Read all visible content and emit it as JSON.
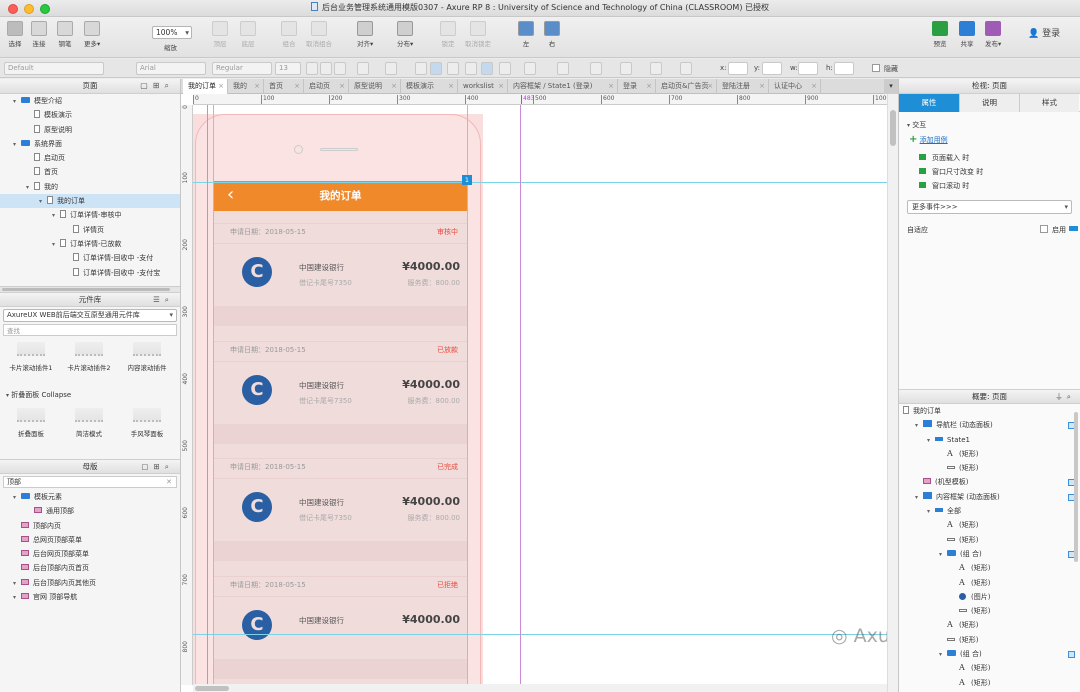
{
  "window": {
    "title": "后台业务管理系统通用模版0307 - Axure RP 8 : University of Science and Technology of China (CLASSROOM) 已授权"
  },
  "toolbar": {
    "tools": [
      {
        "label": "选择"
      },
      {
        "label": "连接"
      },
      {
        "label": "钢笔"
      },
      {
        "label": "更多▾"
      }
    ],
    "zoom_value": "100%",
    "zoom_label": "缩放",
    "arrange": [
      {
        "label": "顶层"
      },
      {
        "label": "底层"
      },
      {
        "label": "组合"
      },
      {
        "label": "取消组合"
      },
      {
        "label": "对齐▾"
      },
      {
        "label": "分布▾"
      },
      {
        "label": "锁定"
      },
      {
        "label": "取消锁定"
      },
      {
        "label": "左"
      },
      {
        "label": "右"
      }
    ],
    "right": [
      {
        "label": "预览"
      },
      {
        "label": "共享"
      },
      {
        "label": "发布▾"
      }
    ],
    "login_label": "登录"
  },
  "format": {
    "style": "Default",
    "font": "Arial",
    "weight": "Regular",
    "size": "13",
    "x_label": "x:",
    "y_label": "y:",
    "w_label": "w:",
    "h_label": "h:",
    "hidden_label": "隐藏"
  },
  "pages_panel": {
    "title": "页面",
    "items": [
      {
        "label": "模型介绍",
        "icon": "folder",
        "indent": 1
      },
      {
        "label": "模板演示",
        "icon": "page",
        "indent": 2
      },
      {
        "label": "原型说明",
        "icon": "page",
        "indent": 2
      },
      {
        "label": "系统界面",
        "icon": "folder",
        "indent": 1
      },
      {
        "label": "启动页",
        "icon": "page",
        "indent": 2
      },
      {
        "label": "首页",
        "icon": "page",
        "indent": 2
      },
      {
        "label": "我的",
        "icon": "page",
        "indent": 2
      },
      {
        "label": "我的订单",
        "icon": "page",
        "indent": 3,
        "selected": true
      },
      {
        "label": "订单详情-审核中",
        "icon": "page",
        "indent": 4
      },
      {
        "label": "详情页",
        "icon": "page",
        "indent": 5
      },
      {
        "label": "订单详情-已放款",
        "icon": "page",
        "indent": 4
      },
      {
        "label": "订单详情-回收中 -支付",
        "icon": "page",
        "indent": 5
      },
      {
        "label": "订单详情-回收中 -支付宝",
        "icon": "page",
        "indent": 5
      }
    ]
  },
  "library_panel": {
    "title": "元件库",
    "selected": "AxureUX WEB前后端交互原型通用元件库",
    "search_placeholder": "查找",
    "row1": [
      {
        "label": "卡片滚动插件1"
      },
      {
        "label": "卡片滚动插件2"
      },
      {
        "label": "内容滚动插件"
      }
    ],
    "section": "折叠面板 Collapse",
    "row2": [
      {
        "label": "折叠面板"
      },
      {
        "label": "简洁模式"
      },
      {
        "label": "手风琴面板"
      }
    ]
  },
  "masters_panel": {
    "title": "母版",
    "search_value": "顶部",
    "items": [
      {
        "label": "模板元素",
        "icon": "folder",
        "indent": 1
      },
      {
        "label": "通用顶部",
        "icon": "master",
        "indent": 2
      },
      {
        "label": "顶部内页",
        "icon": "master",
        "indent": 1
      },
      {
        "label": "总网页顶部菜单",
        "icon": "master",
        "indent": 1
      },
      {
        "label": "后台网页顶部菜单",
        "icon": "master",
        "indent": 1
      },
      {
        "label": "后台顶部内页首页",
        "icon": "master",
        "indent": 1
      },
      {
        "label": "后台顶部内页其他页",
        "icon": "master",
        "indent": 1
      },
      {
        "label": "官网 顶部导航",
        "icon": "master",
        "indent": 1
      }
    ]
  },
  "tabs": [
    {
      "label": "我的订单",
      "active": true
    },
    {
      "label": "我的"
    },
    {
      "label": "首页"
    },
    {
      "label": "启动页"
    },
    {
      "label": "原型说明"
    },
    {
      "label": "模板演示"
    },
    {
      "label": "workslist"
    },
    {
      "label": "内容框架 / State1 (登录)"
    },
    {
      "label": "登录"
    },
    {
      "label": "启动页&广告页"
    },
    {
      "label": "登陆注册"
    },
    {
      "label": "认证中心"
    }
  ],
  "ruler": {
    "h": [
      "0",
      "100",
      "200",
      "300",
      "400",
      "500",
      "600",
      "700",
      "800",
      "900",
      "1000"
    ],
    "v": [
      "0",
      "100",
      "200",
      "300",
      "400",
      "500",
      "600",
      "700",
      "800"
    ],
    "guide_value": "483",
    "badge": "1"
  },
  "phone": {
    "header_title": "我的订单",
    "back_icon": "‹",
    "orders": [
      {
        "date": "申请日期：2018-05-15",
        "status": "审核中",
        "bank": "中国建设银行",
        "card": "借记卡尾号7350",
        "amount": "¥4000.00",
        "fee": "服务费：800.00"
      },
      {
        "date": "申请日期：2018-05-15",
        "status": "已放款",
        "bank": "中国建设银行",
        "card": "借记卡尾号7350",
        "amount": "¥4000.00",
        "fee": "服务费：800.00"
      },
      {
        "date": "申请日期：2018-05-15",
        "status": "已完成",
        "bank": "中国建设银行",
        "card": "借记卡尾号7350",
        "amount": "¥4000.00",
        "fee": "服务费：800.00"
      },
      {
        "date": "申请日期：2018-05-15",
        "status": "已拒绝",
        "bank": "中国建设银行",
        "card": "",
        "amount": "¥4000.00",
        "fee": ""
      }
    ]
  },
  "inspector": {
    "title": "检视: 页面",
    "tabs": [
      {
        "label": "属性",
        "active": true
      },
      {
        "label": "说明"
      },
      {
        "label": "样式"
      }
    ],
    "interaction": "交互",
    "add_case": "添加用例",
    "events": [
      {
        "label": "页面载入 时"
      },
      {
        "label": "窗口尺寸改变 时"
      },
      {
        "label": "窗口滚动 时"
      }
    ],
    "more_events": "更多事件>>>",
    "adaptive": "自适应",
    "enable": "启用"
  },
  "outline": {
    "title": "概要: 页面",
    "items": [
      {
        "label": "我的订单",
        "icon": "page",
        "indent": 0
      },
      {
        "label": "导航栏 (动态面板)",
        "icon": "dp",
        "indent": 1,
        "box": true
      },
      {
        "label": "State1",
        "icon": "state",
        "indent": 2
      },
      {
        "label": "(矩形)",
        "icon": "A",
        "indent": 3
      },
      {
        "label": "(矩形)",
        "icon": "line",
        "indent": 3
      },
      {
        "label": "(机型模板)",
        "icon": "master",
        "indent": 1,
        "box": true
      },
      {
        "label": "内容框架 (动态面板)",
        "icon": "dp",
        "indent": 1,
        "box": true
      },
      {
        "label": "全部",
        "icon": "state",
        "indent": 2
      },
      {
        "label": "(矩形)",
        "icon": "A",
        "indent": 3
      },
      {
        "label": "(矩形)",
        "icon": "line",
        "indent": 3
      },
      {
        "label": "(组 合)",
        "icon": "folder",
        "indent": 3,
        "box": true
      },
      {
        "label": "(矩形)",
        "icon": "A",
        "indent": 4
      },
      {
        "label": "(矩形)",
        "icon": "A",
        "indent": 4
      },
      {
        "label": "(图片)",
        "icon": "img",
        "indent": 4
      },
      {
        "label": "(矩形)",
        "icon": "line",
        "indent": 4
      },
      {
        "label": "(矩形)",
        "icon": "A",
        "indent": 3
      },
      {
        "label": "(矩形)",
        "icon": "line",
        "indent": 3
      },
      {
        "label": "(组 合)",
        "icon": "folder",
        "indent": 3,
        "box": true
      },
      {
        "label": "(矩形)",
        "icon": "A",
        "indent": 4
      },
      {
        "label": "(矩形)",
        "icon": "A",
        "indent": 4
      }
    ]
  },
  "watermark": "Axure技术小站",
  "colors": {
    "orange": "#f0892a",
    "red": "#e84b3c",
    "blue": "#2a5fa3",
    "selected": "#cde4f7",
    "accent": "#1e8fd6"
  }
}
